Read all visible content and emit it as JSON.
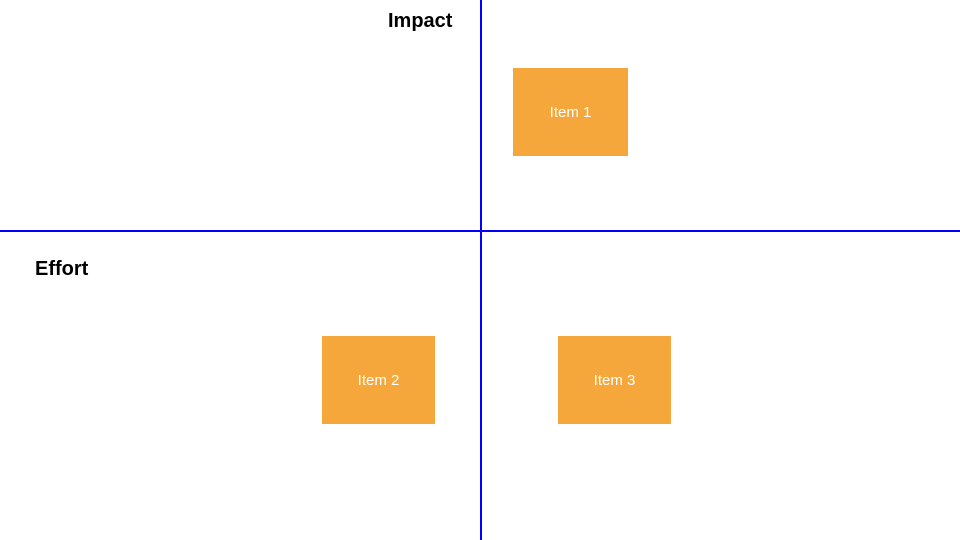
{
  "axes": {
    "vertical_label": "Impact",
    "horizontal_label": "Effort"
  },
  "items": {
    "item1": "Item 1",
    "item2": "Item 2",
    "item3": "Item 3"
  },
  "colors": {
    "axis": "#0000ff",
    "box_fill": "#f6a73b",
    "box_text": "#ffffff"
  }
}
